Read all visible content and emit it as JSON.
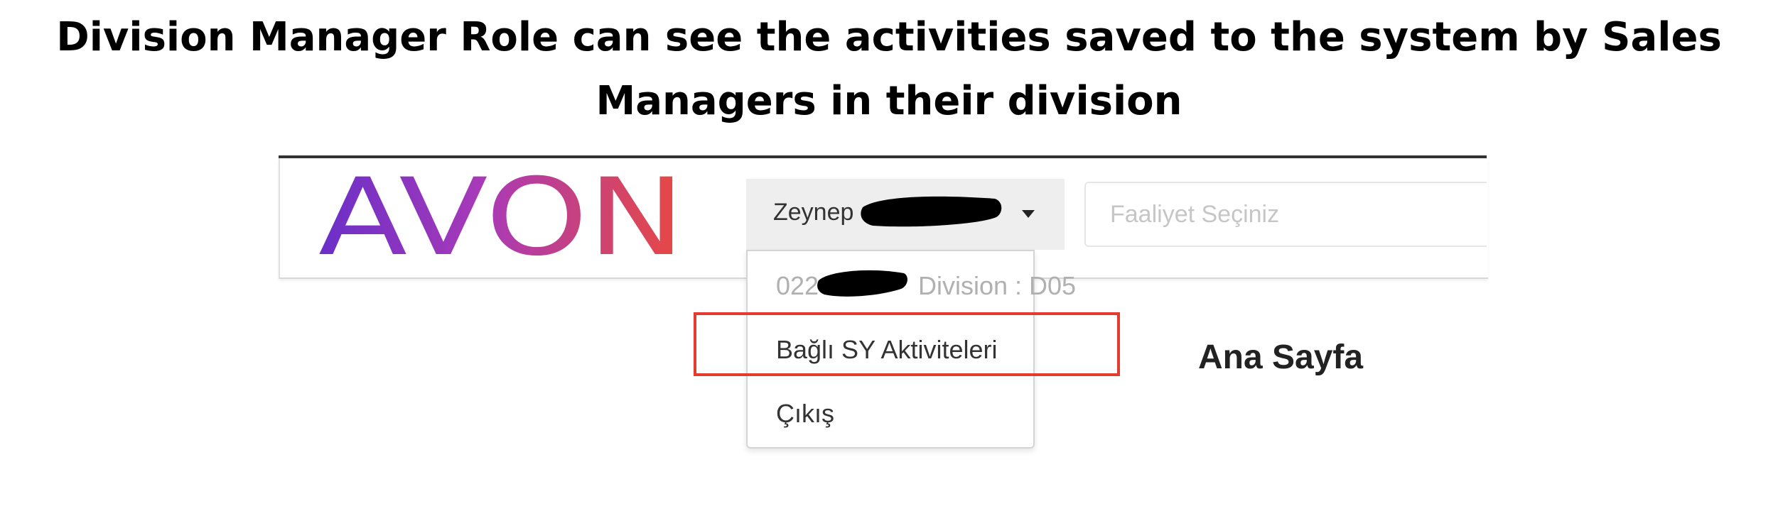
{
  "caption": {
    "line1": "Division Manager Role can see the activities saved to the system by Sales",
    "line2": "Managers in their division"
  },
  "header": {
    "logo_text": "AVON",
    "user_name": "Zeynep",
    "search_placeholder": "Faaliyet Seçiniz"
  },
  "user_menu": {
    "info_code": "022",
    "info_division": "Division : D05",
    "items": [
      {
        "label": "Bağlı SY Aktiviteleri",
        "highlighted": true
      },
      {
        "label": "Çıkış",
        "highlighted": false
      }
    ]
  },
  "main": {
    "page_title": "Ana Sayfa"
  },
  "colors": {
    "highlight_border": "#e53a2f",
    "logo_gradient_start": "#6a2fc8",
    "logo_gradient_end": "#e8493f",
    "redaction": "#000000"
  }
}
